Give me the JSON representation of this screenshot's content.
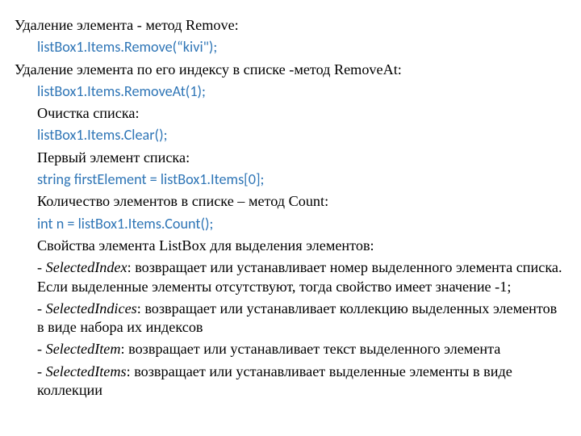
{
  "lines": {
    "l1": "Удаление элемента - метод Remove:",
    "l2": "listBox1.Items.Remove(“kivi\");",
    "l3": "Удаление элемента по его индексу в списке -метод RemoveAt:",
    "l4": "listBox1.Items.RemoveAt(1);",
    "l5": "Очистка списка:",
    "l6": "listBox1.Items.Clear();",
    "l7": "Первый элемент списка:",
    "l8": "string firstElement = listBox1.Items[0];",
    "l9": "Количество элементов в списке – метод Count:",
    "l10": "int n = listBox1.Items.Count();",
    "l11": "Свойства элемента ListBox для выделения элементов:",
    "p1_pre": " - ",
    "p1_kw": "SelectedIndex",
    "p1_rest": ": возвращает или устанавливает номер выделенного элемента списка. Если выделенные элементы отсутствуют, тогда свойство имеет значение -1;",
    "p2_pre": " - ",
    "p2_kw": "SelectedIndices",
    "p2_rest": ": возвращает или устанавливает коллекцию выделенных элементов в виде набора их индексов",
    "p3_pre": " - ",
    "p3_kw": "SelectedItem",
    "p3_rest": ": возвращает или устанавливает текст выделенного элемента",
    "p4_pre": " - ",
    "p4_kw": "SelectedItems",
    "p4_rest": ": возвращает или устанавливает выделенные элементы в виде коллекции"
  }
}
